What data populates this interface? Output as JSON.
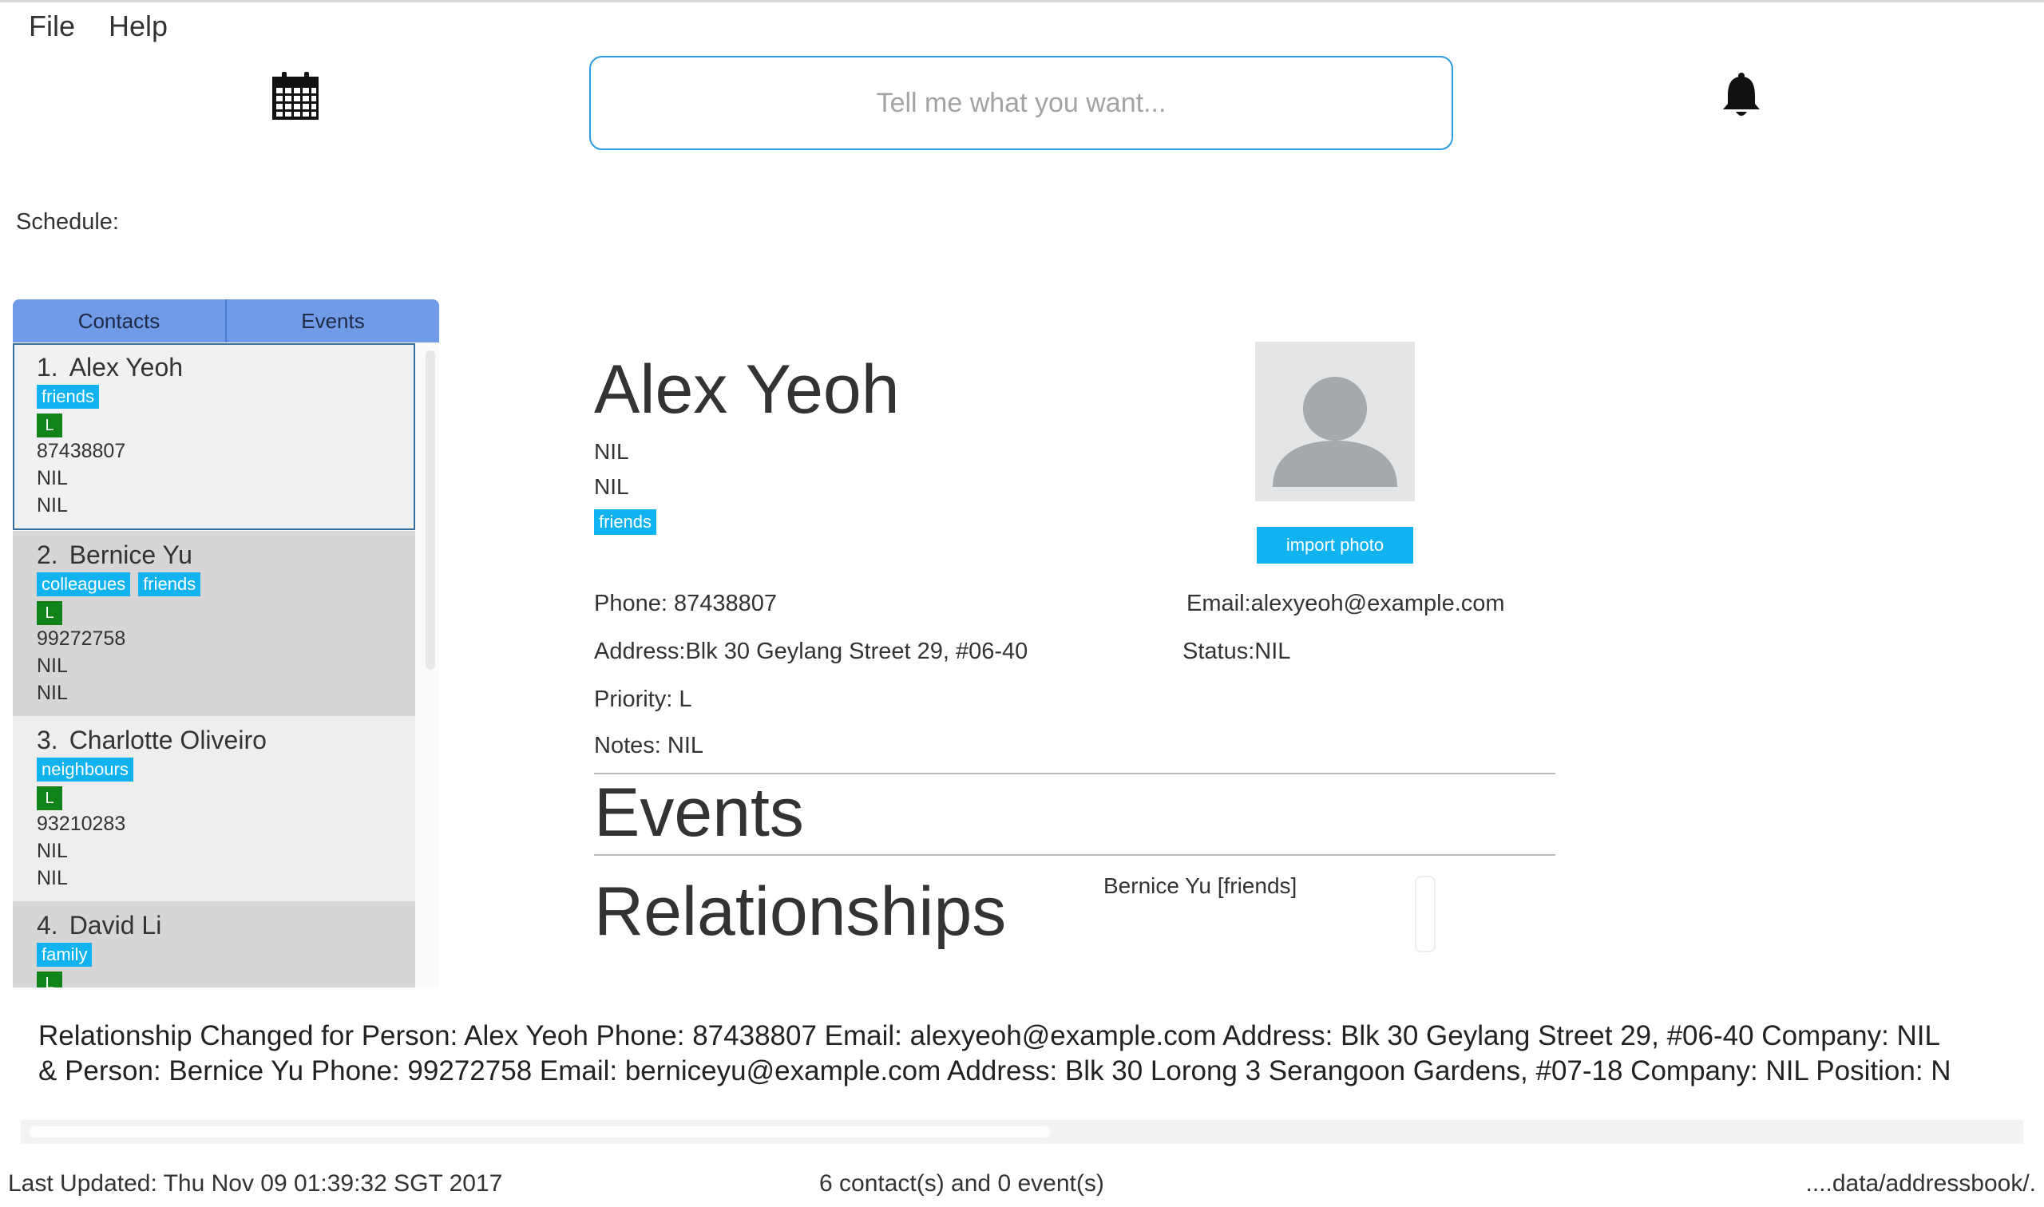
{
  "menu": {
    "file": "File",
    "help": "Help"
  },
  "command_box": {
    "placeholder": "Tell me what you want..."
  },
  "schedule_label": "Schedule:",
  "tabs": {
    "contacts": "Contacts",
    "events": "Events"
  },
  "contacts": [
    {
      "index": "1.",
      "name": "Alex Yeoh",
      "tags": [
        "friends"
      ],
      "priority": "L",
      "phone": "87438807",
      "line2": "NIL",
      "line3": "NIL"
    },
    {
      "index": "2.",
      "name": "Bernice Yu",
      "tags": [
        "colleagues",
        "friends"
      ],
      "priority": "L",
      "phone": "99272758",
      "line2": "NIL",
      "line3": "NIL"
    },
    {
      "index": "3.",
      "name": "Charlotte Oliveiro",
      "tags": [
        "neighbours"
      ],
      "priority": "L",
      "phone": "93210283",
      "line2": "NIL",
      "line3": "NIL"
    },
    {
      "index": "4.",
      "name": "David Li",
      "tags": [
        "family"
      ],
      "priority": "L"
    }
  ],
  "detail": {
    "name": "Alex Yeoh",
    "line1": "NIL",
    "line2": "NIL",
    "tag": "friends",
    "import_photo": "import photo",
    "phone_label": "Phone:",
    "phone": "87438807",
    "email_label": "Email:",
    "email": "alexyeoh@example.com",
    "address_label": "Address:",
    "address": "Blk 30 Geylang Street 29, #06-40",
    "status_label": "Status:",
    "status": "NIL",
    "priority_label": "Priority:",
    "priority": "L",
    "notes_label": "Notes:",
    "notes": "NIL",
    "events_heading": "Events",
    "relationships_heading": "Relationships",
    "relationship_item": "Bernice Yu [friends]"
  },
  "result": {
    "line1": "Relationship Changed for Person: Alex Yeoh Phone: 87438807 Email: alexyeoh@example.com Address: Blk 30 Geylang Street 29, #06-40 Company: NIL",
    "line2": "& Person: Bernice Yu Phone: 99272758 Email: berniceyu@example.com Address: Blk 30 Lorong 3 Serangoon Gardens, #07-18 Company: NIL Position: N"
  },
  "status_bar": {
    "last_updated": "Last Updated: Thu Nov 09 01:39:32 SGT 2017",
    "counts": "6 contact(s) and 0 event(s)",
    "path": "....data/addressbook/."
  },
  "colors": {
    "accent": "#2d9ce0",
    "tag": "#10b3f0",
    "priority": "#10841a",
    "tabs": "#6f9be9"
  },
  "icons": {
    "calendar": "calendar-icon",
    "bell": "bell-icon",
    "avatar": "avatar-icon"
  }
}
